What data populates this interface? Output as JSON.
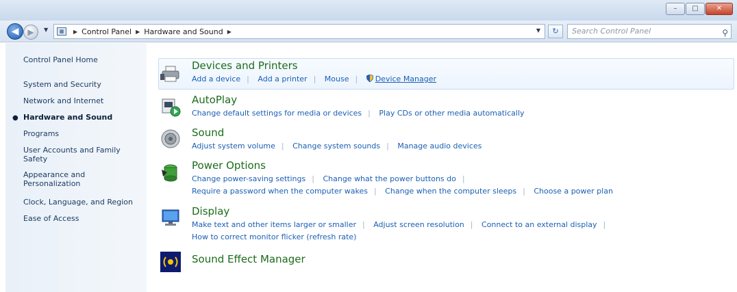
{
  "window": {
    "buttons": {
      "minimize": "–",
      "maximize": "□",
      "close": "✕"
    }
  },
  "address": {
    "crumbs": [
      "Control Panel",
      "Hardware and Sound"
    ],
    "search_placeholder": "Search Control Panel"
  },
  "nav": {
    "items": [
      "Control Panel Home",
      "System and Security",
      "Network and Internet",
      "Hardware and Sound",
      "Programs",
      "User Accounts and Family Safety",
      "Appearance and Personalization",
      "Clock, Language, and Region",
      "Ease of Access"
    ],
    "current": "Hardware and Sound"
  },
  "categories": [
    {
      "title": "Devices and Printers",
      "icon": "printer-icon",
      "lines": [
        [
          "Add a device",
          "Add a printer",
          "Mouse",
          "Device Manager"
        ]
      ]
    },
    {
      "title": "AutoPlay",
      "icon": "autoplay-icon",
      "lines": [
        [
          "Change default settings for media or devices",
          "Play CDs or other media automatically"
        ]
      ]
    },
    {
      "title": "Sound",
      "icon": "speaker-icon",
      "lines": [
        [
          "Adjust system volume",
          "Change system sounds",
          "Manage audio devices"
        ]
      ]
    },
    {
      "title": "Power Options",
      "icon": "battery-icon",
      "lines": [
        [
          "Change power-saving settings",
          "Change what the power buttons do"
        ],
        [
          "Require a password when the computer wakes",
          "Change when the computer sleeps",
          "Choose a power plan"
        ]
      ]
    },
    {
      "title": "Display",
      "icon": "monitor-icon",
      "lines": [
        [
          "Make text and other items larger or smaller",
          "Adjust screen resolution",
          "Connect to an external display"
        ],
        [
          "How to correct monitor flicker (refresh rate)"
        ]
      ]
    },
    {
      "title": "Sound Effect Manager",
      "icon": "sound-effect-icon",
      "lines": []
    }
  ]
}
